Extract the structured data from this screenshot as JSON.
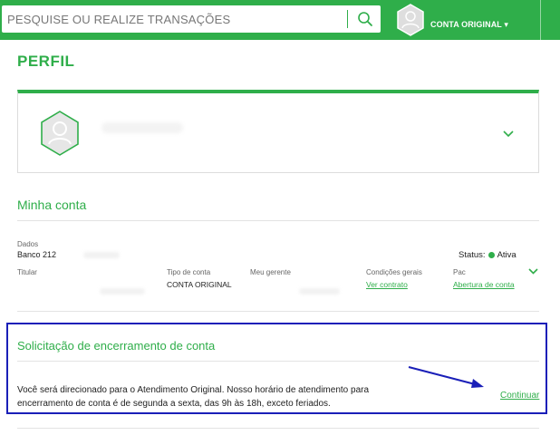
{
  "header": {
    "search_placeholder": "PESQUISE OU REALIZE TRANSAÇÕES",
    "account_label": "CONTA ORIGINAL ▾",
    "brand_color": "#2fae4a"
  },
  "page": {
    "title": "PERFIL"
  },
  "minha_conta": {
    "title": "Minha conta",
    "dados_label": "Dados",
    "bank": "Banco 212",
    "status_label": "Status:",
    "status_value": "Ativa",
    "status_color": "#2fae4a",
    "titular_label": "Titular",
    "tipo_label": "Tipo de conta",
    "tipo_value": "CONTA ORIGINAL",
    "gerente_label": "Meu gerente",
    "condicoes_label": "Condições gerais",
    "condicoes_link": "Ver contrato",
    "pac_label": "Pac",
    "pac_link": "Abertura de conta"
  },
  "encerramento": {
    "title": "Solicitação de encerramento de conta",
    "text": "Você será direcionado para o Atendimento Original. Nosso horário de atendimento para encerramento de conta é de segunda a sexta, das 9h às 18h, exceto feriados.",
    "continue_label": "Continuar",
    "highlight_color": "#1a1fb8"
  },
  "icons": {
    "search": "search-icon",
    "avatar": "user-avatar-icon",
    "chevron": "chevron-down-icon",
    "arrow": "arrow-annotation"
  }
}
